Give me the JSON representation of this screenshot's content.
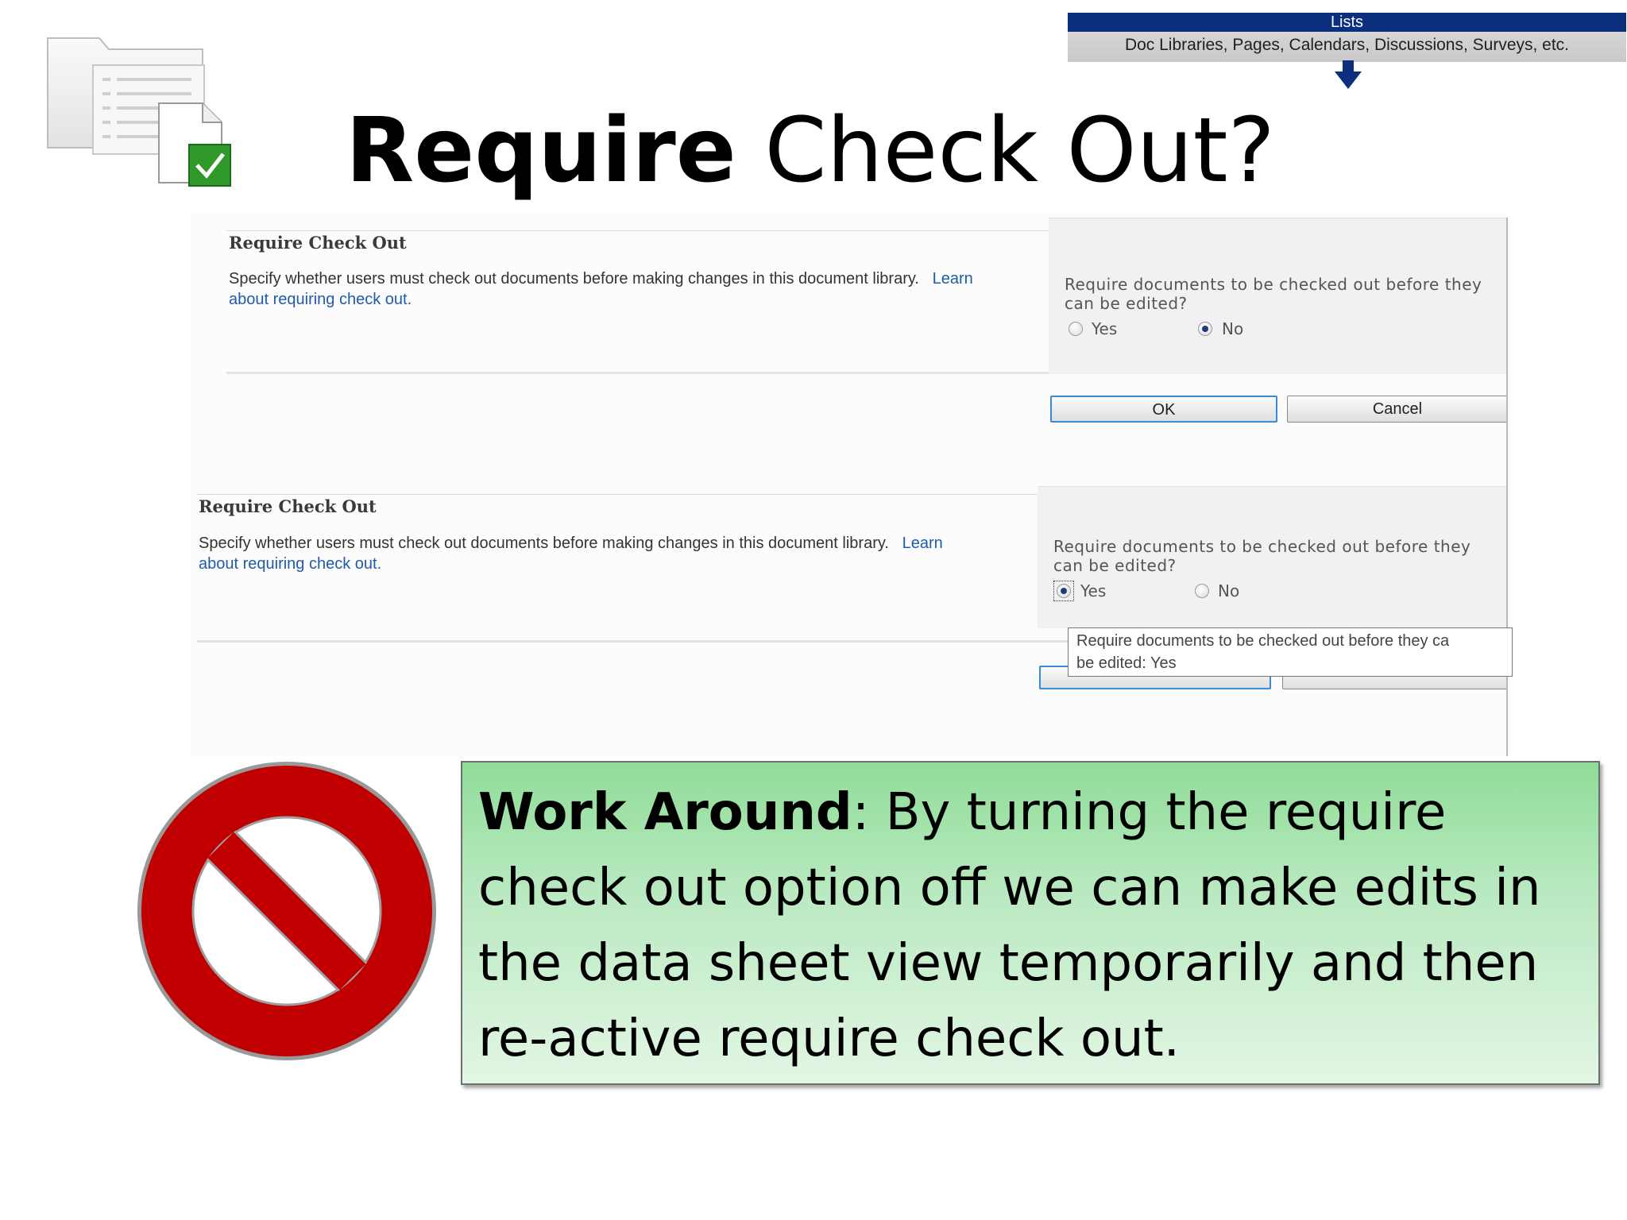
{
  "banner": {
    "top": "Lists",
    "sub": "Doc Libraries, Pages, Calendars, Discussions, Surveys, etc."
  },
  "title": {
    "bold": "Require",
    "rest": " Check Out?"
  },
  "panel1": {
    "section_title": "Require Check Out",
    "desc": "Specify whether users must check out documents before making changes in this document library.",
    "link_1": "Learn",
    "link_2": "about requiring check out.",
    "question_1": "Require documents to be checked out before they",
    "question_2": "can be edited?",
    "yes": "Yes",
    "no": "No",
    "selected": "No",
    "ok": "OK",
    "cancel": "Cancel"
  },
  "panel2": {
    "section_title": "Require Check Out",
    "desc": "Specify whether users must check out documents before making changes in this document library.",
    "link_1": "Learn",
    "link_2": "about requiring check out.",
    "question_1": "Require documents to be checked out before they",
    "question_2": "can be edited?",
    "yes": "Yes",
    "no": "No",
    "selected": "Yes",
    "tooltip_1": "Require documents to be checked out before they ca",
    "tooltip_2": "be edited: Yes"
  },
  "callout": {
    "bold": "Work Around",
    "text": ": By turning the require check out option off we can make edits in the data sheet view temporarily and then re-active require check out."
  },
  "icons": [
    "document-library-icon",
    "checkmark-icon",
    "down-arrow-icon",
    "no-sign-icon"
  ],
  "colors": {
    "banner": "#0b2f7c",
    "no_sign": "#c00000",
    "callout_green": "#8fdc98",
    "link": "#1f5ca8"
  }
}
